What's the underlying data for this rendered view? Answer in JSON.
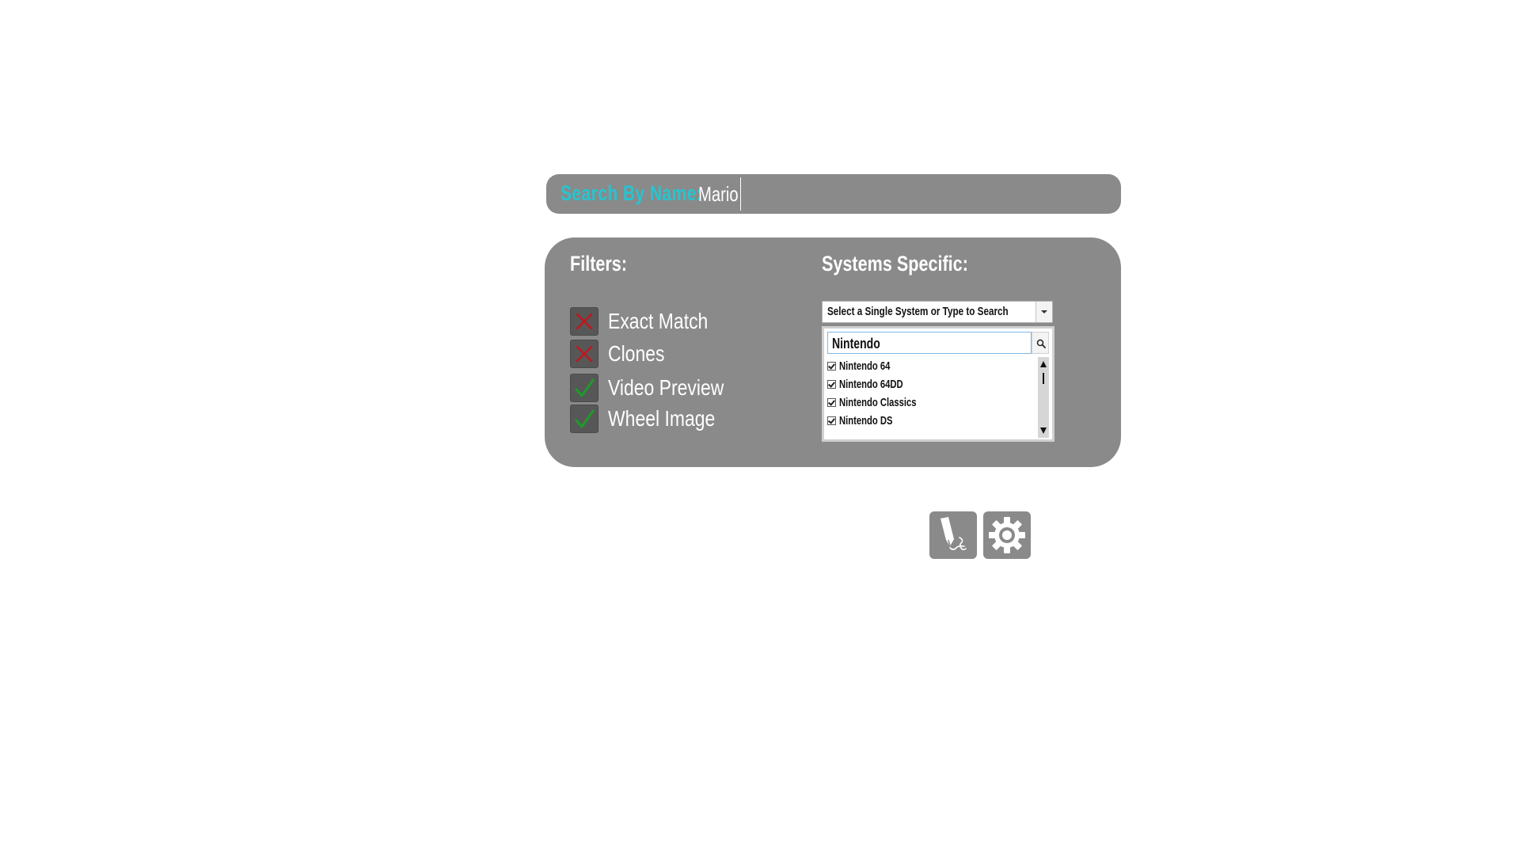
{
  "search": {
    "label": "Search By Name:",
    "value": "Mario"
  },
  "filters": {
    "heading": "Filters:",
    "items": [
      {
        "label": "Exact Match",
        "checked": false
      },
      {
        "label": "Clones",
        "checked": false
      },
      {
        "label": "Video Preview",
        "checked": true
      },
      {
        "label": "Wheel Image",
        "checked": true
      }
    ]
  },
  "systems": {
    "heading": "Systems Specific:",
    "select_placeholder": "Select a Single System or Type to Search",
    "search_value": "Nintendo",
    "options": [
      {
        "label": "Nintendo 64",
        "checked": true
      },
      {
        "label": "Nintendo 64DD",
        "checked": true
      },
      {
        "label": "Nintendo Classics",
        "checked": true
      },
      {
        "label": "Nintendo DS",
        "checked": true
      }
    ]
  },
  "toolbar": {
    "buttons": [
      {
        "name": "signature-pen-icon"
      },
      {
        "name": "gear-icon"
      }
    ]
  },
  "colors": {
    "panel": "#8a8a8a",
    "label_accent": "#27c4cf",
    "check_off": "#c0161e",
    "check_on": "#1e9a2a"
  }
}
